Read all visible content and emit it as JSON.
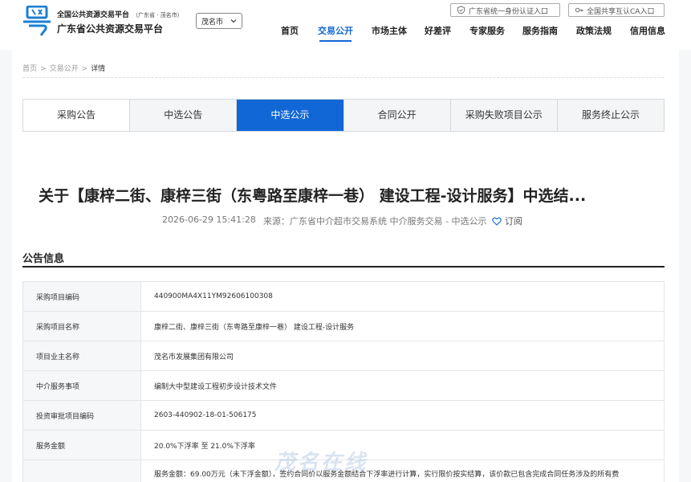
{
  "header": {
    "platform_line1": "全国公共资源交易平台",
    "platform_line1_sub": "（广东省 · 茂名市）",
    "platform_line2": "广东省公共资源交易平台",
    "city": "茂名市",
    "login_unified": "广东省统一身份认证入口",
    "login_ca": "全国共享互认CA入口",
    "nav": [
      "首页",
      "交易公开",
      "市场主体",
      "好差评",
      "专家服务",
      "服务指南",
      "政策法规",
      "信用信息"
    ],
    "active_nav": "交易公开"
  },
  "breadcrumb": [
    "首页",
    ">",
    "交易公开",
    ">",
    "详情"
  ],
  "tabs": [
    "采购公告",
    "中选公告",
    "中选公示",
    "合同公开",
    "采购失败项目公示",
    "服务终止公示"
  ],
  "active_tab": "中选公示",
  "notice": {
    "title": "关于【康梓二街、康梓三街（东粤路至康梓一巷） 建设工程-设计服务】中选结...",
    "date": "2026-06-29 15:41:28",
    "source": "来源：广东省中介超市交易系统 中介服务交易 - 中选公示",
    "subscribe": "订阅"
  },
  "section_title": "公告信息",
  "info_rows": [
    {
      "label": "采购项目编码",
      "value": "440900MA4X11YM92606100308"
    },
    {
      "label": "采购项目名称",
      "value": "康梓二街、康梓三街（东粤路至康梓一巷） 建设工程-设计服务"
    },
    {
      "label": "项目业主名称",
      "value": "茂名市发展集团有限公司"
    },
    {
      "label": "中介服务事项",
      "value": "编制大中型建设工程初步设计技术文件"
    },
    {
      "label": "投资审批项目编码",
      "value": "2603-440902-18-01-506175"
    },
    {
      "label": "服务金额",
      "value": "20.0%下浮率 至 21.0%下浮率"
    },
    {
      "label": "",
      "value": "服务金额：69.00万元（未下浮金额），签约合同价以服务金额结合下浮率进行计算，实行限价按实结算，该价款已包含完成合同任务涉及的所有费"
    }
  ],
  "watermark": "茂名在线",
  "colors": {
    "accent": "#1167d6",
    "text": "#222222",
    "muted": "#777777"
  }
}
